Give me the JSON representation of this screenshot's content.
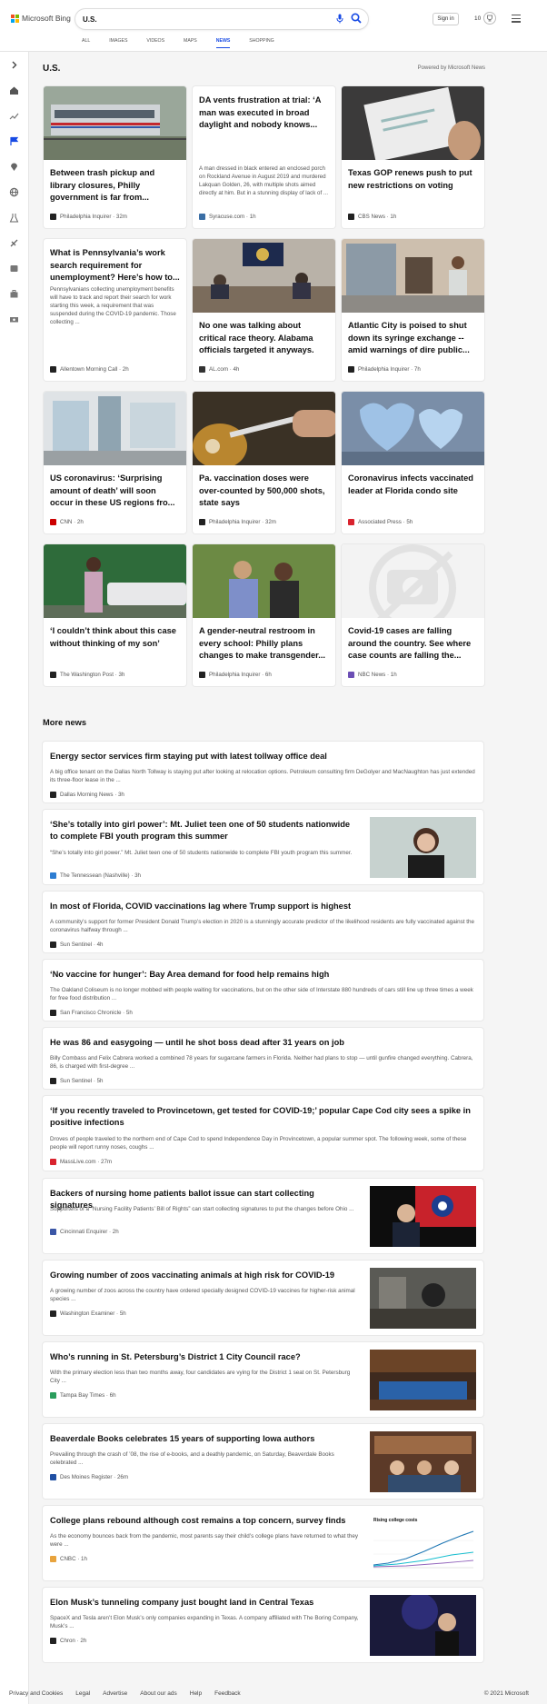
{
  "header": {
    "logo_text": "Microsoft Bing",
    "search_value": "U.S.",
    "signin_label": "Sign in",
    "points": "10",
    "tabs": [
      "ALL",
      "IMAGES",
      "VIDEOS",
      "MAPS",
      "NEWS",
      "SHOPPING"
    ],
    "active_tab": "NEWS"
  },
  "section": {
    "title": "U.S.",
    "powered_by": "Powered by Microsoft News"
  },
  "cards": [
    {
      "title": "Between trash pickup and library closures, Philly government is far from...",
      "provider": "Philadelphia Inquirer",
      "time": "32m",
      "has_image": true,
      "icon_color": "#222"
    },
    {
      "title": "DA vents frustration at trial: ‘A man was executed in broad daylight and nobody knows...",
      "snippet": "A man dressed in black entered an enclosed porch on Rockland Avenue in August 2019 and murdered Lakquan Golden, 26, with multiple shots aimed directly at him. But in a stunning display of lack of ...",
      "provider": "Syracuse.com",
      "time": "1h",
      "has_image": false,
      "icon_color": "#3a6ea5"
    },
    {
      "title": "Texas GOP renews push to put new restrictions on voting",
      "provider": "CBS News",
      "time": "1h",
      "has_image": true,
      "icon_color": "#222"
    },
    {
      "title": "What is Pennsylvania’s work search requirement for unemployment? Here’s how to...",
      "snippet": "Pennsylvanians collecting unemployment benefits will have to track and report their search for work starting this week, a requirement that was suspended during the COVID-19 pandemic. Those collecting ...",
      "provider": "Allentown Morning Call",
      "time": "2h",
      "has_image": false,
      "icon_color": "#222"
    },
    {
      "title": "No one was talking about critical race theory. Alabama officials targeted it anyways.",
      "provider": "AL.com",
      "time": "4h",
      "has_image": true,
      "icon_color": "#333"
    },
    {
      "title": "Atlantic City is poised to shut down its syringe exchange -- amid warnings of dire public...",
      "provider": "Philadelphia Inquirer",
      "time": "7h",
      "has_image": true,
      "icon_color": "#222"
    },
    {
      "title": "US coronavirus: ‘Surprising amount of death’ will soon occur in these US regions fro...",
      "provider": "CNN",
      "time": "2h",
      "has_image": true,
      "icon_color": "#cc0000"
    },
    {
      "title": "Pa. vaccination doses were over-counted by 500,000 shots, state says",
      "provider": "Philadelphia Inquirer",
      "time": "32m",
      "has_image": true,
      "icon_color": "#222"
    },
    {
      "title": "Coronavirus infects vaccinated leader at Florida condo site",
      "provider": "Associated Press",
      "time": "5h",
      "has_image": true,
      "icon_color": "#d9232e"
    },
    {
      "title": "‘I couldn’t think about this case without thinking of my son’",
      "provider": "The Washington Post",
      "time": "3h",
      "has_image": true,
      "icon_color": "#222"
    },
    {
      "title": "A gender-neutral restroom in every school: Philly plans changes to make transgender...",
      "provider": "Philadelphia Inquirer",
      "time": "6h",
      "has_image": true,
      "icon_color": "#222"
    },
    {
      "title": "Covid-19 cases are falling around the country. See where case counts are falling the...",
      "provider": "NBC News",
      "time": "1h",
      "has_image": true,
      "icon_color": "#6c4fb5"
    }
  ],
  "more_news": {
    "title": "More news",
    "items": [
      {
        "title": "Energy sector services firm staying put with latest tollway office deal",
        "snippet": "A big office tenant on the Dallas North Tollway is staying put after looking at relocation options. Petroleum consulting firm DeGolyer and MacNaughton has just extended its three-floor lease in the ...",
        "provider": "Dallas Morning News",
        "time": "3h",
        "icon_color": "#222"
      },
      {
        "title": "‘She’s totally into girl power’: Mt. Juliet teen one of 50 students nationwide to complete FBI youth program this summer",
        "snippet": "“She’s totally into girl power.” Mt. Juliet teen one of 50 students nationwide to complete FBI youth program this summer.",
        "provider": "The Tennessean (Nashville)",
        "time": "3h",
        "icon_color": "#2d7dd2"
      },
      {
        "title": "In most of Florida, COVID vaccinations lag where Trump support is highest",
        "snippet": "A community’s support for former President Donald Trump’s election in 2020 is a stunningly accurate predictor of the likelihood residents are fully vaccinated against the coronavirus halfway through ...",
        "provider": "Sun Sentinel",
        "time": "4h",
        "icon_color": "#222"
      },
      {
        "title": "‘No vaccine for hunger’: Bay Area demand for food help remains high",
        "snippet": "The Oakland Coliseum is no longer mobbed with people waiting for vaccinations, but on the other side of Interstate 880 hundreds of cars still line up three times a week for free food distribution ...",
        "provider": "San Francisco Chronicle",
        "time": "5h",
        "icon_color": "#222"
      },
      {
        "title": "He was 86 and easygoing — until he shot boss dead after 31 years on job",
        "snippet": "Billy Combass and Felix Cabrera worked a combined 78 years for sugarcane farmers in Florida. Neither had plans to stop — until gunfire changed everything. Cabrera, 86, is charged with first-degree ...",
        "provider": "Sun Sentinel",
        "time": "5h",
        "icon_color": "#222"
      },
      {
        "title": "‘If you recently traveled to Provincetown, get tested for COVID-19;’ popular Cape Cod city sees a spike in positive infections",
        "snippet": "Droves of people traveled to the northern end of Cape Cod to spend Independence Day in Provincetown, a popular summer spot. The following week, some of these people will report runny noses, coughs ...",
        "provider": "MassLive.com",
        "time": "27m",
        "icon_color": "#d9232e"
      },
      {
        "title": "Backers of nursing home patients ballot issue can start collecting signatures",
        "snippet": "Supporters of a “Nursing Facility Patients’ Bill of Rights” can start collecting signatures to put the changes before Ohio ...",
        "provider": "Cincinnati Enquirer",
        "time": "2h",
        "icon_color": "#3a56a6"
      },
      {
        "title": "Growing number of zoos vaccinating animals at high risk for COVID-19",
        "snippet": "A growing number of zoos across the country have ordered specially designed COVID-19 vaccines for higher-risk animal species ...",
        "provider": "Washington Examiner",
        "time": "5h",
        "icon_color": "#222"
      },
      {
        "title": "Who’s running in St. Petersburg’s District 1 City Council race?",
        "snippet": "With the primary election less than two months away, four candidates are vying for the District 1 seat on St. Petersburg City ...",
        "provider": "Tampa Bay Times",
        "time": "6h",
        "icon_color": "#2a9d5c"
      },
      {
        "title": "Beaverdale Books celebrates 15 years of supporting Iowa authors",
        "snippet": "Prevailing through the crash of ’08, the rise of e-books, and a deathly pandemic, on Saturday, Beaverdale Books celebrated ...",
        "provider": "Des Moines Register",
        "time": "26m",
        "icon_color": "#1f4fa3"
      },
      {
        "title": "College plans rebound although cost remains a top concern, survey finds",
        "snippet": "As the economy bounces back from the pandemic, most parents say their child’s college plans have returned to what they were ...",
        "provider": "CNBC",
        "time": "1h",
        "icon_color": "#e8a33d"
      },
      {
        "title": "Elon Musk’s tunneling company just bought land in Central Texas",
        "snippet": "SpaceX and Tesla aren’t Elon Musk’s only companies expanding in Texas. A company affiliated with The Boring Company, Musk’s ...",
        "provider": "Chron",
        "time": "2h",
        "icon_color": "#222"
      }
    ],
    "chart_thumb_title": "Rising college costs"
  },
  "footer": {
    "links": [
      "Privacy and Cookies",
      "Legal",
      "Advertise",
      "About our ads",
      "Help",
      "Feedback"
    ],
    "copyright": "© 2021 Microsoft"
  }
}
